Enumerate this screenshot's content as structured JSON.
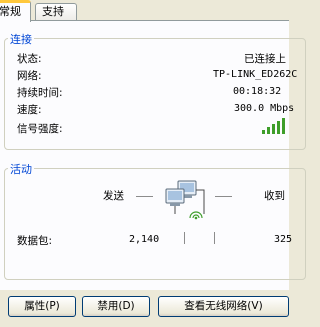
{
  "tabs": [
    {
      "label": "常规",
      "active": true
    },
    {
      "label": "支持",
      "active": false
    }
  ],
  "connection": {
    "title": "连接",
    "rows": [
      {
        "label": "状态:",
        "value": "已连接上"
      },
      {
        "label": "网络:",
        "value": "TP-LINK_ED262C"
      },
      {
        "label": "持续时间:",
        "value": "00:18:32"
      },
      {
        "label": "速度:",
        "value": "300.0 Mbps"
      }
    ],
    "signal_label": "信号强度:",
    "signal_level": 5,
    "signal_max": 5
  },
  "activity": {
    "title": "活动",
    "sent_label": "发送",
    "received_label": "收到",
    "packets_label": "数据包:",
    "packets_sent": "2,140",
    "packets_received": "325"
  },
  "buttons": {
    "properties": "属性(P)",
    "disable": "禁用(D)",
    "view_networks": "查看无线网络(V)"
  },
  "colors": {
    "accent_tab": "#ffc83c",
    "group_title": "#0046d5",
    "signal_bar": "#3e9e2a"
  }
}
